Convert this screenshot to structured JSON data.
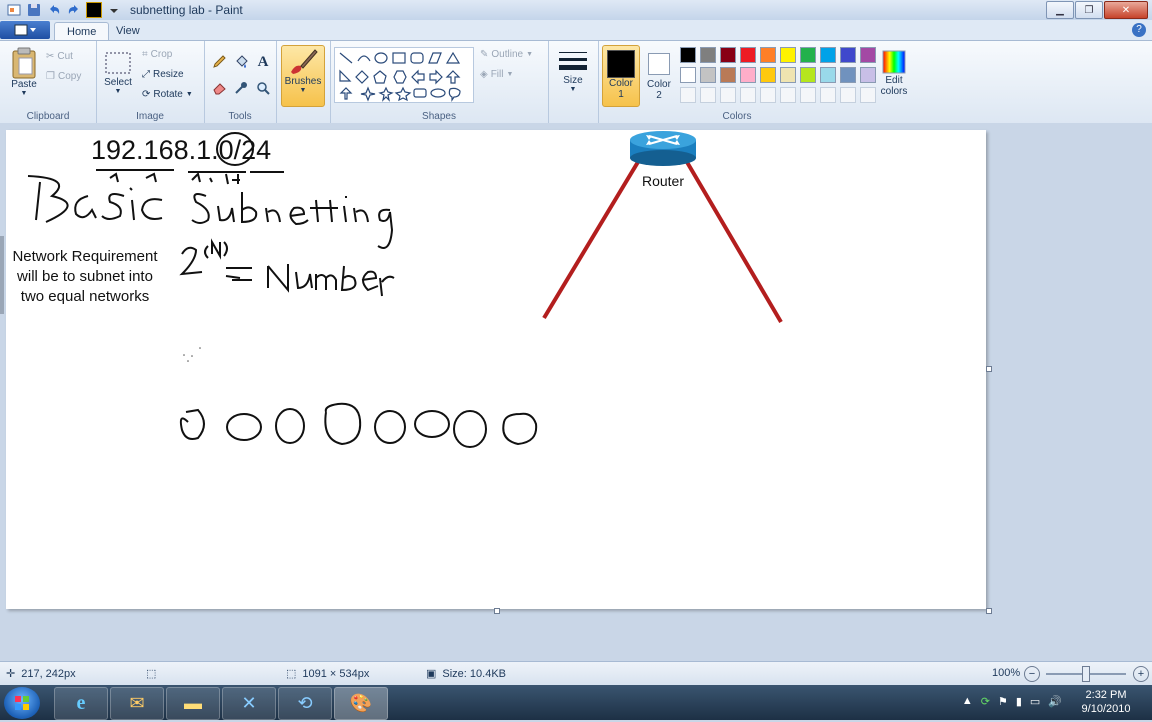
{
  "window": {
    "title": "subnetting lab - Paint"
  },
  "tabs": [
    {
      "label": "Home"
    },
    {
      "label": "View"
    }
  ],
  "ribbon": {
    "clipboard": {
      "label": "Clipboard",
      "paste": "Paste",
      "cut": "Cut",
      "copy": "Copy"
    },
    "image": {
      "label": "Image",
      "select": "Select",
      "crop": "Crop",
      "resize": "Resize",
      "rotate": "Rotate"
    },
    "tools": {
      "label": "Tools"
    },
    "brushes": {
      "label": "Brushes"
    },
    "shapes": {
      "label": "Shapes",
      "outline": "Outline",
      "fill": "Fill"
    },
    "size": {
      "label": "Size"
    },
    "color1": {
      "line1": "Color",
      "line2": "1"
    },
    "color2": {
      "line1": "Color",
      "line2": "2"
    },
    "colors": {
      "label": "Colors"
    },
    "edit_colors": {
      "line1": "Edit",
      "line2": "colors"
    },
    "palette": [
      "#000000",
      "#7f7f7f",
      "#880015",
      "#ed1c24",
      "#ff7f27",
      "#fff200",
      "#22b14c",
      "#00a2e8",
      "#3f48cc",
      "#a349a4",
      "#ffffff",
      "#c3c3c3",
      "#b97a57",
      "#ffaec9",
      "#ffc90e",
      "#efe4b0",
      "#b5e61d",
      "#99d9ea",
      "#7092be",
      "#c8bfe7"
    ],
    "color1_value": "#000000",
    "color2_value": "#ffffff"
  },
  "canvas": {
    "ip_text": "192.168.1.0/24",
    "basic_subnetting": "Basic Subnetting",
    "network_requirement": [
      "Network Requirement",
      "will be to subnet into",
      "two equal networks"
    ],
    "formula": "2(N) = Number",
    "router_label": "Router"
  },
  "status": {
    "cursor_pos": "217, 242px",
    "canvas_size": "1091 × 534px",
    "file_size": "Size: 10.4KB",
    "zoom": "100%"
  },
  "taskbar": {
    "time": "2:32 PM",
    "date": "9/10/2010"
  }
}
